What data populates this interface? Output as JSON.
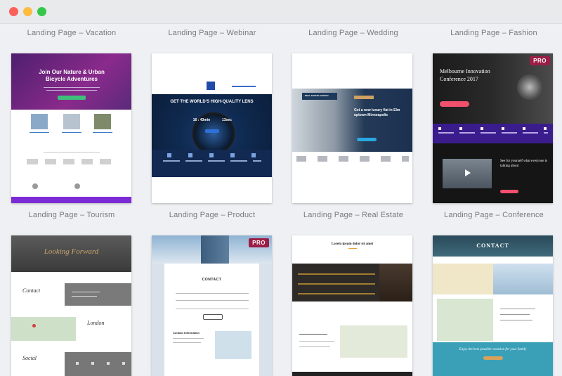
{
  "window": {
    "controls": [
      "close",
      "minimize",
      "zoom"
    ]
  },
  "templates": [
    {
      "label": "Landing Page – Vacation",
      "heading": "Join Our Nature & Urban Bicycle Adventures",
      "pro": false
    },
    {
      "label": "Landing Page – Webinar",
      "heading": "GET THE WORLD'S HIGH-QUALITY LENS",
      "stats": [
        "16 : 43min",
        "13sec"
      ],
      "pro": false
    },
    {
      "label": "Landing Page – Wedding",
      "badge": "REAL ESTATE AGENCY",
      "heading": "Get a new luxury flat in Elm uptown Minneapolis",
      "pro": false
    },
    {
      "label": "Landing Page – Fashion",
      "heading": "Melbourne Innovation Conference 2017",
      "subheading": "See for yourself what everyone is talking about",
      "pro": true,
      "pro_label": "PRO"
    },
    {
      "label": "Landing Page – Tourism",
      "heading": "Looking Forward",
      "section1": "Contact",
      "section2": "London",
      "section3": "Social",
      "pro": false
    },
    {
      "label": "Landing Page – Product",
      "heading": "CONTACT",
      "info_title": "Contact Information",
      "pro": true,
      "pro_label": "PRO"
    },
    {
      "label": "Landing Page – Real Estate",
      "heading": "Lorem ipsum dolor sit amet",
      "pro": false
    },
    {
      "label": "Landing Page – Conference",
      "heading": "CONTACT",
      "footer": "Enjoy the best possible vacation for your family",
      "pro": false
    }
  ]
}
